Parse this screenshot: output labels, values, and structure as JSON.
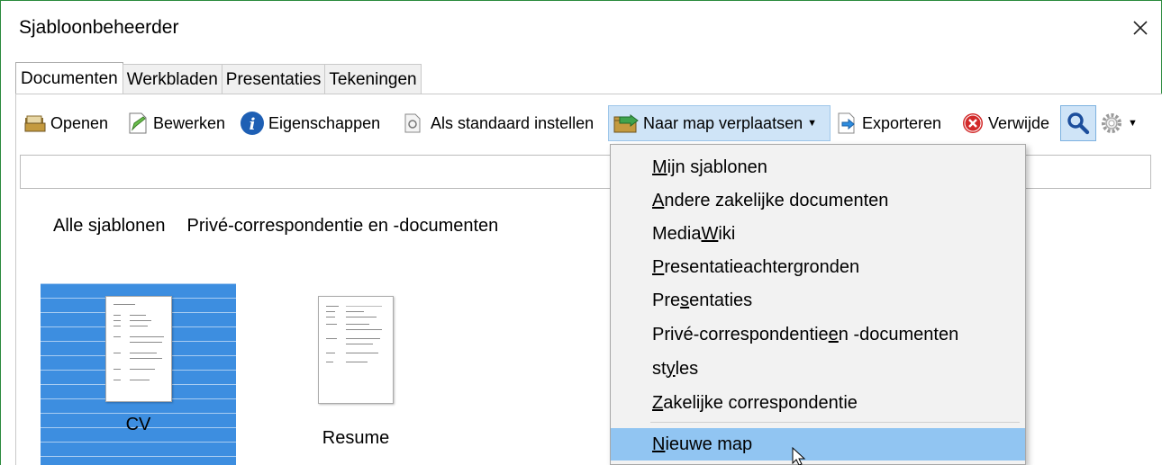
{
  "window": {
    "title": "Sjabloonbeheerder"
  },
  "tabs": [
    {
      "label": "Documenten",
      "active": true
    },
    {
      "label": "Werkbladen",
      "active": false
    },
    {
      "label": "Presentaties",
      "active": false
    },
    {
      "label": "Tekeningen",
      "active": false
    }
  ],
  "toolbar": {
    "open": "Openen",
    "edit": "Bewerken",
    "properties": "Eigenschappen",
    "set_default": "Als standaard instellen",
    "move_to_folder": "Naar map verplaatsen",
    "export": "Exporteren",
    "delete": "Verwijde"
  },
  "search": {
    "value": ""
  },
  "breadcrumb": {
    "root": "Alle sjablonen",
    "current": "Privé-correspondentie en -documenten"
  },
  "templates": [
    {
      "label": "CV",
      "selected": true
    },
    {
      "label": "Resume",
      "selected": false
    }
  ],
  "move_menu": {
    "items": [
      {
        "pre": "",
        "u": "M",
        "post": "ijn sjablonen"
      },
      {
        "pre": "",
        "u": "A",
        "post": "ndere zakelijke documenten"
      },
      {
        "pre": "Media",
        "u": "W",
        "post": "iki"
      },
      {
        "pre": "",
        "u": "P",
        "post": "resentatieachtergronden"
      },
      {
        "pre": "Pre",
        "u": "s",
        "post": "entaties"
      },
      {
        "pre": "Privé-correspondentie ",
        "u": "e",
        "post": "n -documenten"
      },
      {
        "pre": "st",
        "u": "y",
        "post": "les"
      },
      {
        "pre": "",
        "u": "Z",
        "post": "akelijke correspondentie"
      }
    ],
    "new_folder": {
      "pre": "",
      "u": "N",
      "post": "ieuwe map"
    }
  },
  "colors": {
    "selection": "#3d8ee0",
    "menu_hover": "#91c5f2",
    "window_border": "#2a8a3c"
  }
}
